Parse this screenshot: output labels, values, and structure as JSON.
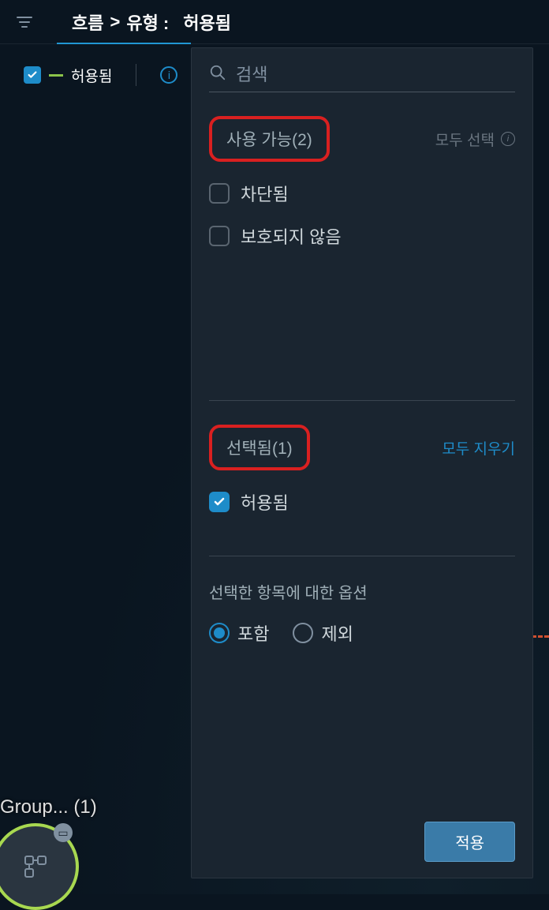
{
  "breadcrumb": {
    "flow": "흐름",
    "separator": ">",
    "type_label": "유형 :",
    "value": "허용됨"
  },
  "chip": {
    "label": "허용됨"
  },
  "search": {
    "placeholder": "검색"
  },
  "available": {
    "label": "사용 가능(2)",
    "select_all": "모두 선택",
    "options": [
      {
        "label": "차단됨",
        "checked": false
      },
      {
        "label": "보호되지 않음",
        "checked": false
      }
    ]
  },
  "selected": {
    "label": "선택됨(1)",
    "clear_all": "모두 지우기",
    "options": [
      {
        "label": "허용됨",
        "checked": true
      }
    ]
  },
  "selected_options": {
    "title": "선택한 항목에 대한 옵션",
    "include": "포함",
    "exclude": "제외"
  },
  "buttons": {
    "apply": "적용"
  },
  "graph": {
    "group_label": "Group... (1)"
  }
}
